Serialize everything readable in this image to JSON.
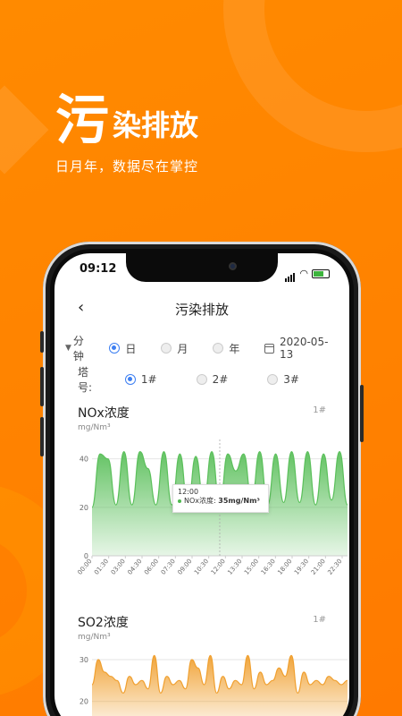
{
  "hero": {
    "big_char": "污",
    "rest_title": "染排放",
    "subtitle": "日月年，数据尽在掌控"
  },
  "status_bar": {
    "time": "09:12"
  },
  "nav": {
    "back_icon": "chevron-left-icon",
    "title": "污染排放"
  },
  "filter": {
    "unit_label": "分钟",
    "options": [
      {
        "label": "日",
        "selected": true
      },
      {
        "label": "月",
        "selected": false
      },
      {
        "label": "年",
        "selected": false
      }
    ],
    "date": "2020-05-13"
  },
  "tower": {
    "label": "塔号:",
    "options": [
      {
        "label": "1#",
        "selected": true
      },
      {
        "label": "2#",
        "selected": false
      },
      {
        "label": "3#",
        "selected": false
      }
    ]
  },
  "colors": {
    "accent": "#ff8a00",
    "radio": "#3d7ff2",
    "nox": "#5cc05c",
    "so2": "#f0a030"
  },
  "tooltip": {
    "time": "12:00",
    "label": "NOx浓度: ",
    "value": "35mg/Nm³"
  },
  "chart_data": [
    {
      "type": "area",
      "title": "NOx浓度",
      "ylabel": "mg/Nm³",
      "tag": "1#",
      "ylim": [
        0,
        48
      ],
      "yticks": [
        0,
        20,
        40
      ],
      "xticks": [
        "00:00",
        "01:30",
        "03:00",
        "04:30",
        "06:00",
        "07:30",
        "09:00",
        "10:30",
        "12:00",
        "13:30",
        "15:00",
        "16:30",
        "18:00",
        "19:30",
        "21:00",
        "22:30"
      ],
      "x": [
        "00:00",
        "00:45",
        "01:30",
        "02:15",
        "03:00",
        "03:45",
        "04:30",
        "05:15",
        "06:00",
        "06:45",
        "07:30",
        "08:15",
        "09:00",
        "09:45",
        "10:30",
        "11:15",
        "12:00",
        "12:45",
        "13:30",
        "14:15",
        "15:00",
        "15:45",
        "16:30",
        "17:15",
        "18:00",
        "18:45",
        "19:30",
        "20:15",
        "21:00",
        "21:45",
        "22:30",
        "23:15",
        "23:59"
      ],
      "values": [
        20,
        42,
        40,
        21,
        43,
        21,
        43,
        36,
        21,
        43,
        21,
        42,
        21,
        41,
        22,
        43,
        21,
        42,
        35,
        42,
        23,
        43,
        21,
        42,
        22,
        43,
        22,
        43,
        21,
        42,
        23,
        43,
        21
      ],
      "grid": true
    },
    {
      "type": "area",
      "title": "SO2浓度",
      "ylabel": "mg/Nm³",
      "tag": "1#",
      "ylim": [
        15,
        33
      ],
      "yticks": [
        20,
        30
      ],
      "values": [
        24,
        30,
        27,
        26,
        25,
        22,
        26,
        24,
        25,
        23,
        31,
        22,
        26,
        24,
        25,
        23,
        30,
        28,
        24,
        31,
        22,
        26,
        23,
        25,
        24,
        31,
        23,
        27,
        24,
        25,
        28,
        26,
        31,
        22,
        27,
        24,
        25,
        24,
        26,
        25,
        24,
        25
      ],
      "grid": true
    }
  ]
}
